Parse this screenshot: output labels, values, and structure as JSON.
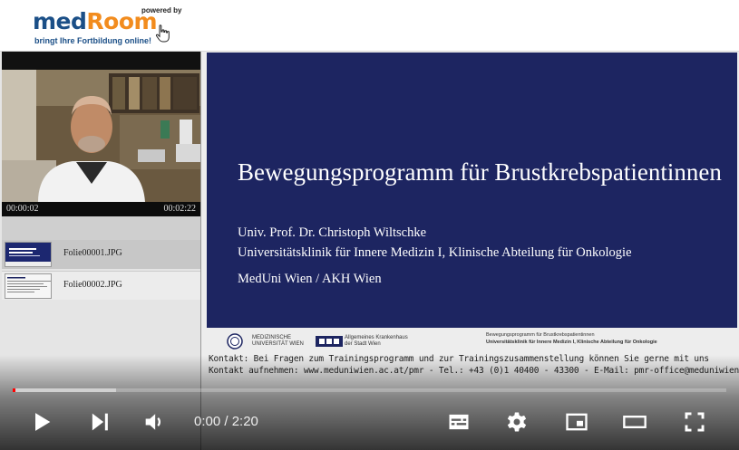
{
  "header": {
    "brand_part1": "med",
    "brand_part2": "Room",
    "powered": "powered by",
    "tagline": "bringt Ihre Fortbildung online!",
    "brand_blue": "#1b4f87",
    "brand_orange": "#f28c1e"
  },
  "camera": {
    "time_elapsed": "00:00:02",
    "time_total": "00:02:22"
  },
  "slides_list": [
    {
      "name": "Folie00001.JPG",
      "selected": true
    },
    {
      "name": "Folie00002.JPG",
      "selected": false
    }
  ],
  "slide": {
    "title": "Bewegungsprogramm für Brustkrebspatientinnen",
    "author": "Univ. Prof. Dr. Christoph Wiltschke",
    "clinic": "Universitätsklinik für Innere Medizin I, Klinische Abteilung für Onkologie",
    "site": "MedUni Wien / AKH Wien",
    "background": "#1d2561"
  },
  "slide_footer": {
    "uni_line1": "Medizinische",
    "uni_line2": "Universität Wien",
    "akh_line1": "Allgemeines Krankenhaus",
    "akh_line2": "der Stadt Wien",
    "program": "Bewegungsprogramm für Brustkrebspatientinnen",
    "clinic_short": "Universitätsklinik für Innere Medizin I, Klinische Abteilung für Onkologie",
    "contact_line1": "Kontakt: Bei Fragen zum Trainingsprogramm und zur Trainingszusammenstellung können Sie gerne mit uns",
    "contact_line2": "Kontakt aufnehmen: www.meduniwien.ac.at/pmr - Tel.: +43 (0)1 40400 - 43300 - E-Mail: pmr-office@meduniwien.ac.at"
  },
  "player": {
    "time_display": "0:00 / 2:20",
    "progress_played_fraction": 0.004,
    "progress_buffered_fraction": 0.145,
    "accent": "#ff0000",
    "icons": {
      "play": "play-icon",
      "next": "next-icon",
      "volume": "volume-icon",
      "subtitles": "subtitles-icon",
      "settings": "gear-icon",
      "miniplayer": "miniplayer-icon",
      "theater": "theater-icon",
      "fullscreen": "fullscreen-icon"
    }
  }
}
